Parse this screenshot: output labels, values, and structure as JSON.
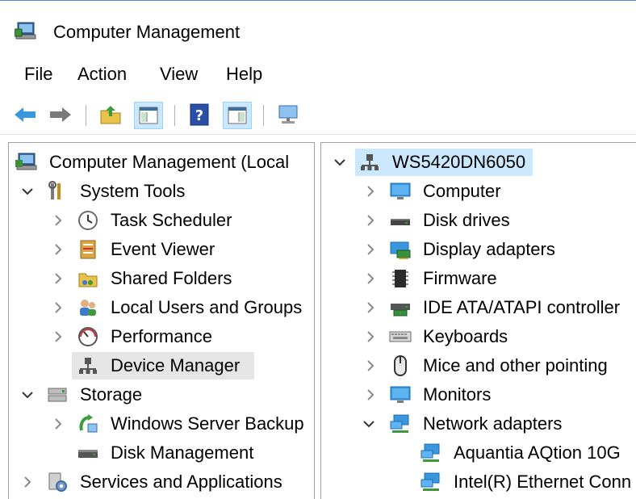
{
  "window": {
    "title": "Computer Management"
  },
  "menu": [
    "File",
    "Action",
    "View",
    "Help"
  ],
  "toolbar": {
    "buttons": [
      "back-arrow",
      "forward-arrow",
      "up-folder",
      "show-hide-console-tree",
      "help",
      "show-hide-action-pane",
      "console-screen"
    ]
  },
  "left_tree": {
    "root": "Computer Management (Local",
    "items": [
      {
        "label": "System Tools",
        "expanded": true
      },
      {
        "label": "Task Scheduler"
      },
      {
        "label": "Event Viewer"
      },
      {
        "label": "Shared Folders"
      },
      {
        "label": "Local Users and Groups"
      },
      {
        "label": "Performance"
      },
      {
        "label": "Device Manager",
        "selected": true
      },
      {
        "label": "Storage",
        "expanded": true
      },
      {
        "label": "Windows Server Backup"
      },
      {
        "label": "Disk Management"
      },
      {
        "label": "Services and Applications",
        "expanded": false
      }
    ]
  },
  "right_tree": {
    "root": "WS5420DN6050",
    "items": [
      {
        "label": "Computer"
      },
      {
        "label": "Disk drives"
      },
      {
        "label": "Display adapters"
      },
      {
        "label": "Firmware"
      },
      {
        "label": "IDE ATA/ATAPI controller"
      },
      {
        "label": "Keyboards"
      },
      {
        "label": "Mice and other pointing"
      },
      {
        "label": "Monitors"
      },
      {
        "label": "Network adapters",
        "expanded": true
      },
      {
        "label": "Aquantia AQtion 10G"
      },
      {
        "label": "Intel(R) Ethernet Conn"
      }
    ]
  },
  "colors": {
    "selection_gray": "#e5e5e5",
    "selection_blue": "#cce8ff",
    "arrow_blue": "#3a96dd"
  }
}
